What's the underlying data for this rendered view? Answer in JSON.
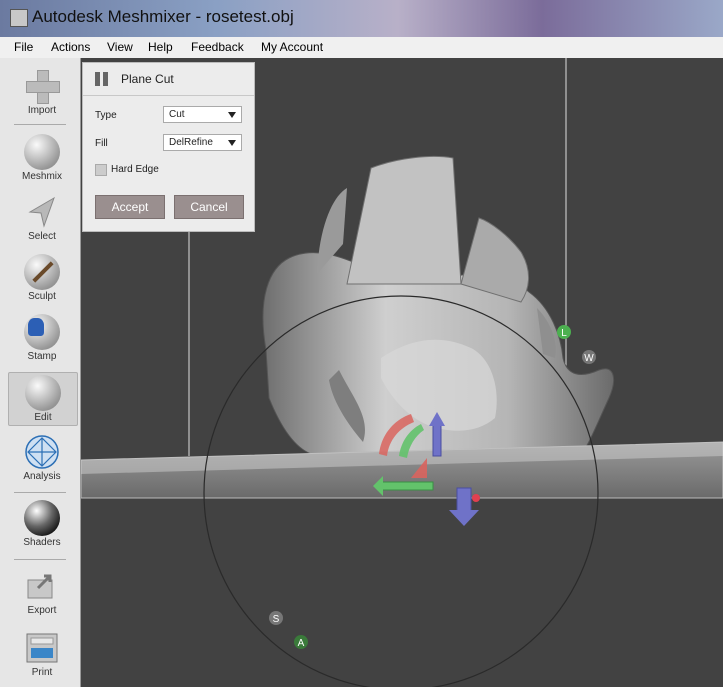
{
  "window": {
    "title": "Autodesk Meshmixer - rosetest.obj"
  },
  "menu": [
    "File",
    "Actions",
    "View",
    "Help",
    "Feedback",
    "My Account"
  ],
  "tools": [
    {
      "label": "Import",
      "icon": "import-icon"
    },
    {
      "label": "Meshmix",
      "icon": "meshmix-icon"
    },
    {
      "label": "Select",
      "icon": "select-icon"
    },
    {
      "label": "Sculpt",
      "icon": "sculpt-icon"
    },
    {
      "label": "Stamp",
      "icon": "stamp-icon"
    },
    {
      "label": "Edit",
      "icon": "edit-icon",
      "active": true
    },
    {
      "label": "Analysis",
      "icon": "analysis-icon"
    },
    {
      "label": "Shaders",
      "icon": "shaders-icon"
    },
    {
      "label": "Export",
      "icon": "export-icon"
    },
    {
      "label": "Print",
      "icon": "print-icon"
    }
  ],
  "panel": {
    "title": "Plane Cut",
    "type_label": "Type",
    "type_value": "Cut",
    "fill_label": "Fill",
    "fill_value": "DelRefine",
    "hard_edge_label": "Hard Edge",
    "hard_edge_checked": false,
    "accept_label": "Accept",
    "cancel_label": "Cancel"
  },
  "viewport": {
    "gizmo_labels": {
      "l": "L",
      "w": "W",
      "s": "S",
      "a": "A"
    },
    "colors": {
      "red": "#d9645e",
      "green": "#63c26b",
      "blue": "#6f72c8",
      "gizmo_ring": "#2a2a2a"
    }
  }
}
